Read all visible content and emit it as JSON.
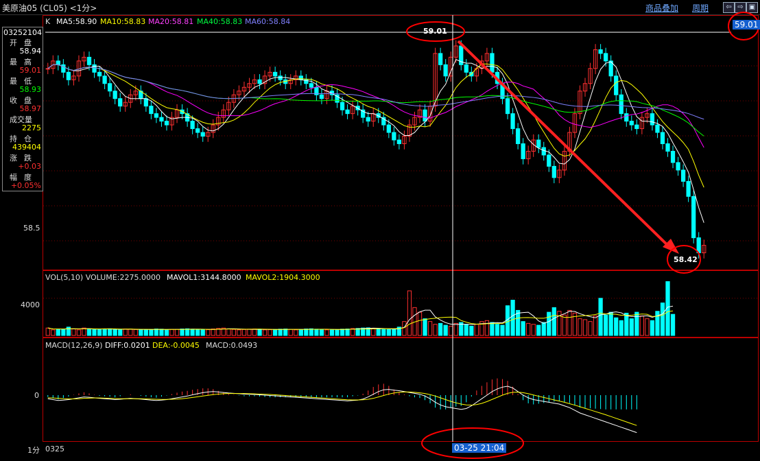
{
  "window": {
    "title": "美原油05 (CL05) <1分>"
  },
  "toolbar": {
    "overlay_label": "商品叠加",
    "period_label": "周期",
    "nav_left": "⇦",
    "nav_right": "⇨",
    "nav_max": "▣"
  },
  "info_panel": {
    "code": "03252104",
    "open_label": "开盘",
    "open_value": "58.94",
    "high_label": "最高",
    "high_value": "59.01",
    "low_label": "最低",
    "low_value": "58.93",
    "close_label": "收盘",
    "close_value": "58.97",
    "volume_label": "成交量",
    "volume_value": "2275",
    "oi_label": "持仓",
    "oi_value": "439404",
    "change_label": "涨跌",
    "change_value": "+0.03",
    "pct_label": "幅度",
    "pct_value": "+0.05%"
  },
  "price_panel": {
    "k_label": "K",
    "ma5": "MA5:58.90",
    "ma10": "MA10:58.83",
    "ma20": "MA20:58.81",
    "ma40": "MA40:58.83",
    "ma60": "MA60:58.84",
    "current_price_tag": "59.01",
    "high_annotation": "59.01",
    "low_annotation": "58.42",
    "ticks": [
      "58.5"
    ],
    "colors": {
      "ma5": "#ffffff",
      "ma10": "#ffff00",
      "ma20": "#ff00ff",
      "ma40": "#00ff00",
      "ma60": "#8080ff",
      "up": "#ff3030",
      "down": "#00ffff",
      "arrow": "#ff2020"
    }
  },
  "volume_panel": {
    "header": "VOL(5,10) VOLUME:2275.0000",
    "mavol1": "MAVOL1:3144.8000",
    "mavol2": "MAVOL2:1904.3000",
    "tick": "4000"
  },
  "macd_panel": {
    "header": "MACD(12,26,9)",
    "diff": "DIFF:0.0201",
    "dea": "DEA:-0.0045",
    "macd": "MACD:0.0493",
    "tick": "0"
  },
  "footer": {
    "period": "1分",
    "date_left": "0325",
    "cursor_time": "03-25 21:04"
  },
  "chart_data": {
    "type": "candlestick",
    "y_range": [
      58.4,
      59.02
    ],
    "closes": [
      58.92,
      58.94,
      58.93,
      58.91,
      58.89,
      58.9,
      58.94,
      58.95,
      58.93,
      58.91,
      58.9,
      58.88,
      58.86,
      58.84,
      58.82,
      58.83,
      58.85,
      58.86,
      58.84,
      58.82,
      58.8,
      58.79,
      58.78,
      58.77,
      58.79,
      58.81,
      58.8,
      58.78,
      58.76,
      58.75,
      58.74,
      58.75,
      58.77,
      58.79,
      58.81,
      58.83,
      58.85,
      58.86,
      58.87,
      58.88,
      58.89,
      58.88,
      58.9,
      58.91,
      58.9,
      58.89,
      58.88,
      58.89,
      58.9,
      58.89,
      58.88,
      58.87,
      58.85,
      58.84,
      58.86,
      58.85,
      58.83,
      58.81,
      58.8,
      58.82,
      58.81,
      58.79,
      58.78,
      58.8,
      58.79,
      58.77,
      58.75,
      58.73,
      58.72,
      58.74,
      58.77,
      58.79,
      58.81,
      58.78,
      58.82,
      58.96,
      58.93,
      58.9,
      58.95,
      58.98,
      58.93,
      58.91,
      58.9,
      58.92,
      58.94,
      58.96,
      58.91,
      58.88,
      58.84,
      58.8,
      58.76,
      58.72,
      58.68,
      58.7,
      58.73,
      58.71,
      58.69,
      58.66,
      58.63,
      58.65,
      58.7,
      58.75,
      58.8,
      58.86,
      58.88,
      58.92,
      58.97,
      58.96,
      58.94,
      58.9,
      58.85,
      58.8,
      58.78,
      58.77,
      58.76,
      58.79,
      58.8,
      58.77,
      58.75,
      58.72,
      58.7,
      58.67,
      58.65,
      58.62,
      58.58,
      58.47,
      58.43,
      58.45
    ],
    "volume": [
      800,
      600,
      700,
      650,
      900,
      700,
      600,
      800,
      700,
      650,
      700,
      680,
      720,
      650,
      600,
      700,
      690,
      640,
      600,
      620,
      650,
      700,
      680,
      600,
      640,
      660,
      700,
      720,
      680,
      650,
      600,
      620,
      700,
      760,
      800,
      700,
      650,
      600,
      640,
      680,
      700,
      650,
      600,
      620,
      640,
      680,
      700,
      650,
      600,
      640,
      700,
      720,
      680,
      650,
      600,
      620,
      640,
      680,
      700,
      750,
      760,
      800,
      820,
      780,
      700,
      650,
      640,
      700,
      900,
      1500,
      4800,
      3000,
      2500,
      1800,
      1500,
      1200,
      1300,
      1100,
      1000,
      1300,
      1400,
      1200,
      1000,
      1200,
      1500,
      1600,
      1400,
      1200,
      1100,
      3200,
      3800,
      2700,
      1500,
      1300,
      1200,
      1100,
      1400,
      2500,
      3000,
      2600,
      2200,
      2700,
      2400,
      1800,
      1700,
      1500,
      2100,
      4000,
      2200,
      2500,
      1900,
      1600,
      2400,
      1800,
      2500,
      2100,
      1800,
      1600,
      2600,
      3500,
      5800,
      2275
    ],
    "diff": [
      -0.02,
      -0.025,
      -0.03,
      -0.028,
      -0.025,
      -0.02,
      -0.015,
      -0.01,
      -0.012,
      -0.015,
      -0.018,
      -0.02,
      -0.022,
      -0.025,
      -0.023,
      -0.02,
      -0.018,
      -0.02,
      -0.022,
      -0.025,
      -0.028,
      -0.03,
      -0.028,
      -0.025,
      -0.02,
      -0.015,
      -0.01,
      -0.005,
      0.002,
      0.008,
      0.014,
      0.018,
      0.02,
      0.018,
      0.015,
      0.012,
      0.01,
      0.008,
      0.006,
      0.005,
      0.004,
      0.002,
      0.0,
      -0.002,
      -0.004,
      -0.006,
      -0.008,
      -0.01,
      -0.012,
      -0.014,
      -0.016,
      -0.018,
      -0.02,
      -0.022,
      -0.024,
      -0.026,
      -0.028,
      -0.03,
      -0.032,
      -0.03,
      -0.028,
      -0.022,
      -0.01,
      0.005,
      0.02,
      0.03,
      0.032,
      0.028,
      0.025,
      0.02,
      0.015,
      0.01,
      0.005,
      -0.005,
      -0.02,
      -0.04,
      -0.055,
      -0.065,
      -0.07,
      -0.075,
      -0.08,
      -0.075,
      -0.06,
      -0.04,
      -0.02,
      0.0,
      0.02,
      0.035,
      0.045,
      0.05,
      0.04,
      0.02,
      0.0,
      -0.015,
      -0.025,
      -0.03,
      -0.035,
      -0.04,
      -0.045,
      -0.05,
      -0.06,
      -0.07,
      -0.085,
      -0.1,
      -0.11,
      -0.12,
      -0.13,
      -0.14,
      -0.15,
      -0.16,
      -0.17,
      -0.18,
      -0.19,
      -0.2,
      -0.21
    ],
    "dea": [
      -0.015,
      -0.016,
      -0.018,
      -0.02,
      -0.021,
      -0.021,
      -0.02,
      -0.018,
      -0.017,
      -0.016,
      -0.016,
      -0.017,
      -0.018,
      -0.019,
      -0.02,
      -0.02,
      -0.02,
      -0.02,
      -0.02,
      -0.021,
      -0.022,
      -0.023,
      -0.024,
      -0.024,
      -0.023,
      -0.022,
      -0.02,
      -0.017,
      -0.013,
      -0.009,
      -0.005,
      -0.001,
      0.003,
      0.006,
      0.008,
      0.009,
      0.009,
      0.009,
      0.009,
      0.008,
      0.007,
      0.006,
      0.005,
      0.004,
      0.002,
      0.0,
      -0.002,
      -0.004,
      -0.006,
      -0.008,
      -0.01,
      -0.012,
      -0.014,
      -0.016,
      -0.018,
      -0.02,
      -0.022,
      -0.024,
      -0.026,
      -0.027,
      -0.027,
      -0.026,
      -0.023,
      -0.018,
      -0.01,
      -0.002,
      0.006,
      0.012,
      0.016,
      0.018,
      0.018,
      0.016,
      0.013,
      0.009,
      0.003,
      -0.005,
      -0.015,
      -0.025,
      -0.035,
      -0.043,
      -0.05,
      -0.055,
      -0.056,
      -0.053,
      -0.046,
      -0.036,
      -0.024,
      -0.012,
      0.0,
      0.01,
      0.016,
      0.017,
      0.014,
      0.008,
      0.001,
      -0.006,
      -0.013,
      -0.02,
      -0.027,
      -0.033,
      -0.04,
      -0.048,
      -0.056,
      -0.065,
      -0.074,
      -0.083,
      -0.092,
      -0.101,
      -0.11,
      -0.12,
      -0.13,
      -0.14,
      -0.15,
      -0.16,
      -0.17
    ]
  }
}
